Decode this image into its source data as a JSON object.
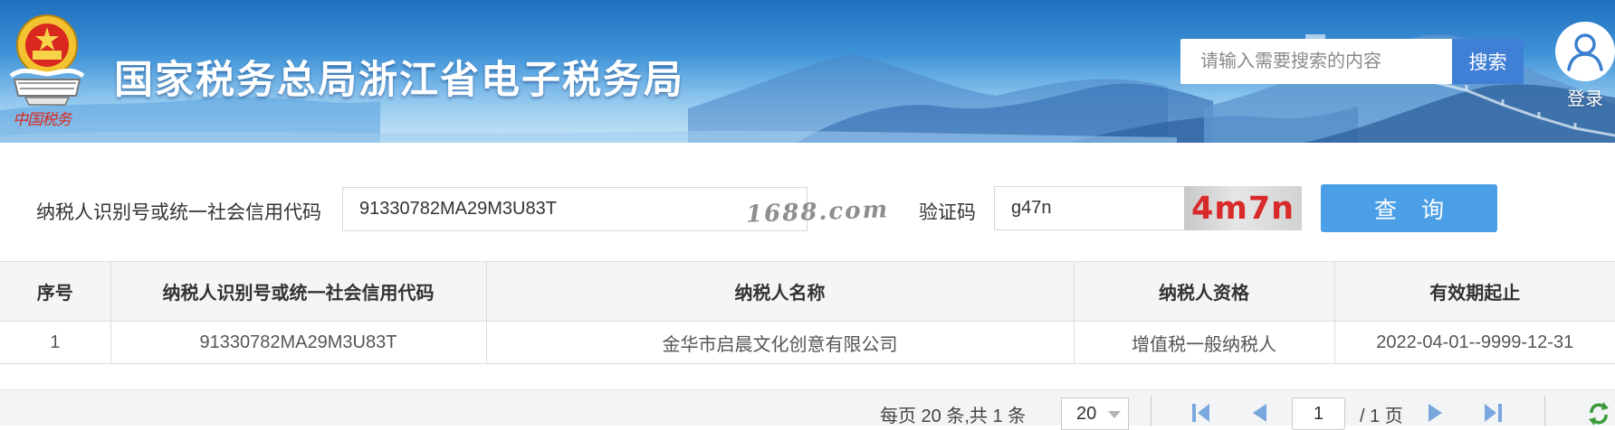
{
  "header": {
    "emblem_signature": "中国税务",
    "site_title": "国家税务总局浙江省电子税务局",
    "search_placeholder": "请输入需要搜索的内容",
    "search_button": "搜索",
    "login_label": "登录"
  },
  "query_form": {
    "taxpayer_id_label": "纳税人识别号或统一社会信用代码",
    "taxpayer_id_value": "91330782MA29M3U83T",
    "watermark": "1688.com",
    "captcha_label": "验证码",
    "captcha_value": "g47n",
    "captcha_image_text": "4m7n",
    "query_button": "查 询"
  },
  "results": {
    "columns": [
      "序号",
      "纳税人识别号或统一社会信用代码",
      "纳税人名称",
      "纳税人资格",
      "有效期起止"
    ],
    "rows": [
      [
        "1",
        "91330782MA29M3U83T",
        "金华市启晨文化创意有限公司",
        "增值税一般纳税人",
        "2022-04-01--9999-12-31"
      ]
    ]
  },
  "pagination": {
    "info": "每页 20 条,共 1 条",
    "page_size": "20",
    "current_page": "1",
    "total_pages": "/ 1 页"
  },
  "colors": {
    "search_button": "#3f7fd6",
    "query_button": "#4a9fe6",
    "captcha_text": "#d82a2a",
    "pager_icons": "#7aa7dd",
    "refresh_icon": "#3a9a3a"
  }
}
